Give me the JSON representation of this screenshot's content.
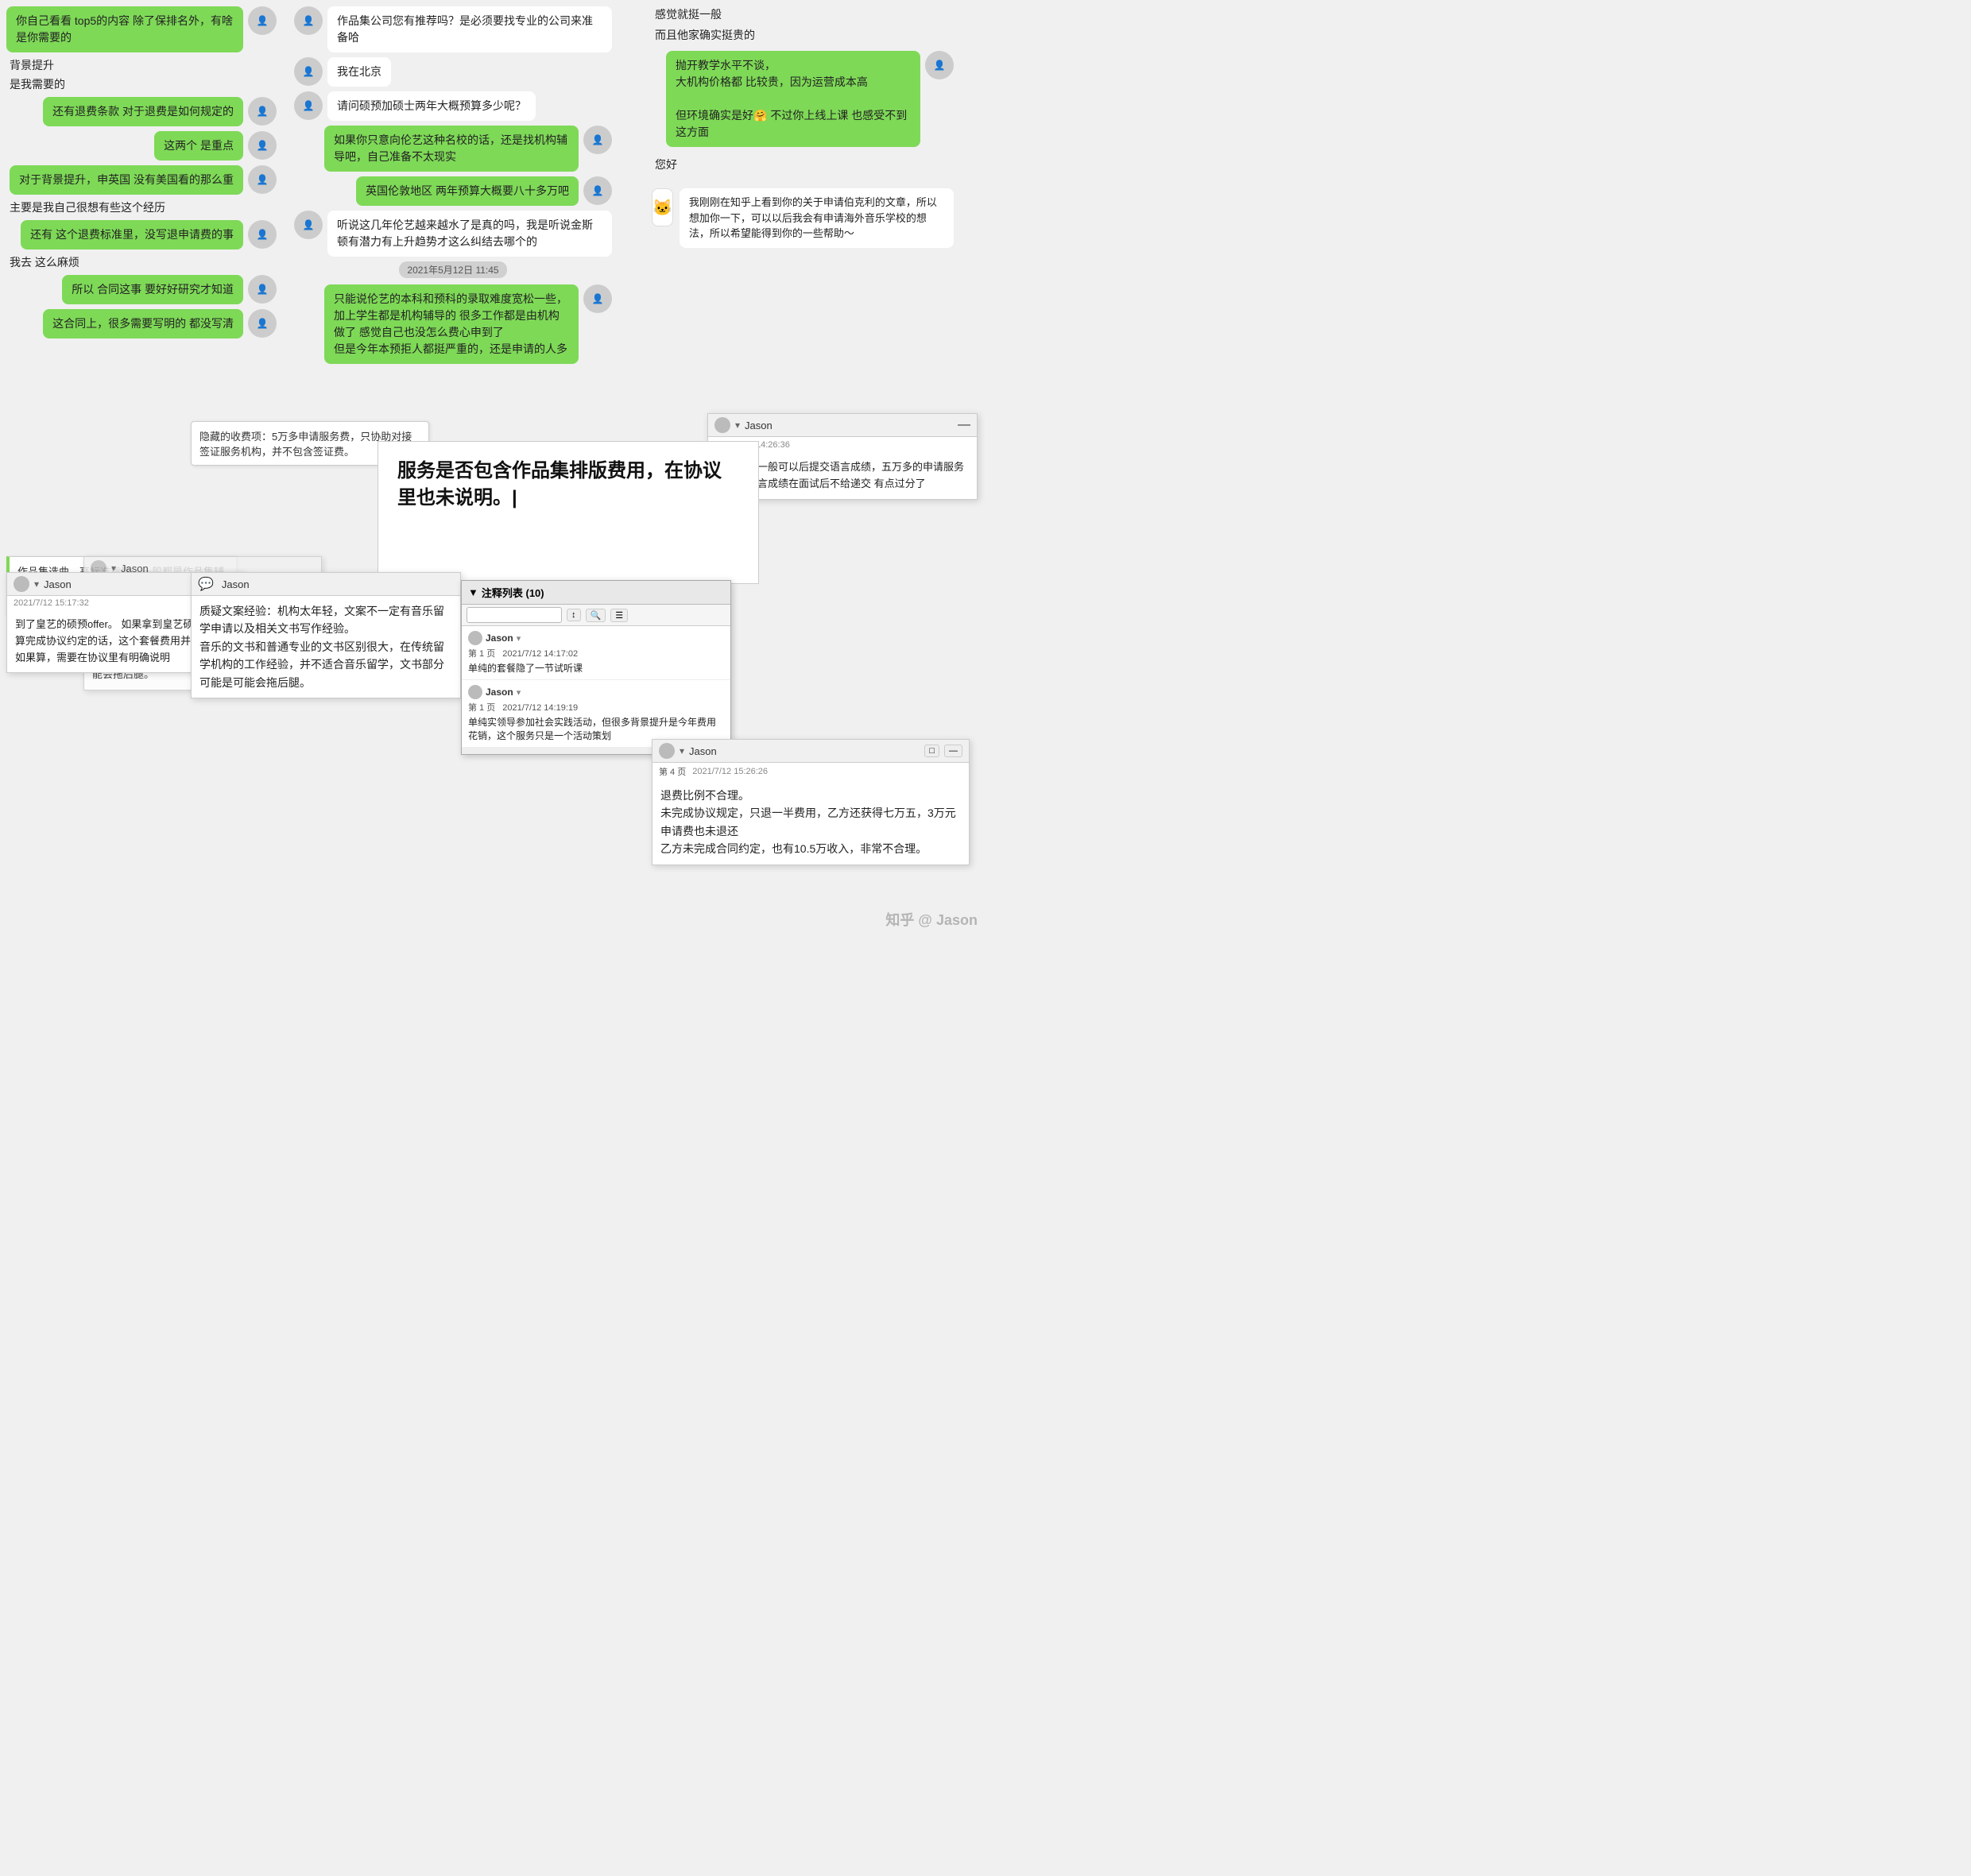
{
  "colors": {
    "green": "#7ed957",
    "white": "#ffffff",
    "bg": "#f5f5f5",
    "panel_bg": "#f0f0f0"
  },
  "chat_column_left": {
    "messages": [
      {
        "text": "你自己看看 top5的内容 除了保排名外，有啥是你需要的",
        "type": "green",
        "align": "right"
      },
      {
        "text": "背景提升",
        "type": "left_plain"
      },
      {
        "text": "是我需要的",
        "type": "left_plain"
      },
      {
        "text": "还有退费条款 对于退费是如何规定的",
        "type": "green",
        "align": "right"
      },
      {
        "text": "这两个 是重点",
        "type": "green",
        "align": "right"
      },
      {
        "text": "对于背景提升，申英国 没有美国看的那么重",
        "type": "green",
        "align": "right"
      },
      {
        "text": "主要是我自己很想有些这个经历",
        "type": "left_plain"
      },
      {
        "text": "还有 这个退费标准里，没写退申请费的事",
        "type": "green",
        "align": "right"
      },
      {
        "text": "我去 这么麻烦",
        "type": "left_plain"
      },
      {
        "text": "所以 合同这事 要好好研究才知道",
        "type": "green",
        "align": "right"
      },
      {
        "text": "这合同上，很多需要写明的 都没写清",
        "type": "green",
        "align": "right"
      }
    ]
  },
  "chat_column_middle": {
    "messages": [
      {
        "text": "作品集公司您有推荐吗？是必须要找专业的公司来准备哈",
        "type": "white"
      },
      {
        "text": "我在北京",
        "type": "white"
      },
      {
        "text": "请问硕预加硕士两年大概预算多少呢？",
        "type": "white"
      },
      {
        "text": "如果你只意向伦艺这种名校的话，还是找机构辅导吧，自己准备不太现实",
        "type": "green"
      },
      {
        "text": "英国伦敦地区 两年预算大概要八十多万吧",
        "type": "green"
      },
      {
        "text": "听说这几年伦艺越来越水了是真的吗，我是听说金斯顿有潜力有上升趋势才这么纠结去哪个的",
        "type": "white"
      },
      {
        "date": "2021年5月12日 11:45"
      },
      {
        "text": "只能说伦艺的本科和预科的录取难度宽松一些，加上学生都是机构辅导的 很多工作都是由机构做了 感觉自己也没怎么费心申到了\n但是今年本预拒人都挺严重的，还是申请的人多",
        "type": "green"
      }
    ]
  },
  "chat_column_right": {
    "messages": [
      {
        "text": "感觉就挺一般",
        "type": "right_plain"
      },
      {
        "text": "而且他家确实挺贵的",
        "type": "right_plain"
      },
      {
        "text": "抛开教学水平不谈，\n大机构价格都 比较贵，因为运营成本高\n\n但环境确实是好🤗 不过你上线上课 也感受不到这方面",
        "type": "green"
      },
      {
        "text": "您好",
        "type": "right_plain"
      }
    ]
  },
  "panel_top_right": {
    "user": "Jason",
    "timestamp": "2021/7/12 14:26:36",
    "text": "英国院校一般可以后提交语言成绩，五万多的申请服务费，却语言成绩在面试后不给递交 有点过分了"
  },
  "panel_hidden_fees": {
    "text": "隐藏的收费项：5万多申请服务费，只协助对接签证服务机构，并不包含签证费。"
  },
  "panel_service_question": {
    "text": "服务是否包含作品集排版费用，在协议里也未说明。",
    "has_cursor": true
  },
  "panel_jason_complaint": {
    "user": "Jason",
    "timestamp": "2021/7/12 15:17:32",
    "text": "到了皇艺的硕预offer。\n如果拿到皇艺硕预录取也算完成协议约定的话，这个套餐费用并不合理。\n如果算，需要在协议里有明确说明"
  },
  "panel_jason_complaint_shadow": {
    "user": "Jason",
    "timestamp": "2021/7/12 14:",
    "text": "质疑文案经验：机构太年轻，文案不一定有音乐留学申请以及相关文书写作经验。\n音乐的文书和普通专业的文书区别很大，在传统留学机构的工作经验，并不适合音乐留学，文书部分可能是可能会拖后腿。"
  },
  "panel_jason_big": {
    "user": "Jason",
    "text": "质疑文案经验：机构太年轻，文案不一定有音乐留学申请以及相关文书写作经验。\n音乐的文书和普通专业的文书区别很大，在传统留学机构的工作经验，并不适合音乐留学，文书部分可能是可能会拖后腿。"
  },
  "panel_refund": {
    "user": "Jason",
    "page": "第 4 页",
    "timestamp": "2021/7/12 15:26:26",
    "text": "退费比例不合理。\n未完成协议规定，只退一半费用，乙方还获得七万五，3万元申请费也未退还\n乙方未完成合同约定，也有10.5万收入，非常不合理。"
  },
  "annotation_panel": {
    "title": "注释列表 (10)",
    "search_placeholder": "",
    "items": [
      {
        "user": "Jason",
        "page": "第 1 页",
        "timestamp": "2021/7/12 14:17:02",
        "text": "单纯的套餐隐了一节试听课"
      },
      {
        "user": "Jason",
        "page": "第 1 页",
        "timestamp": "2021/7/12 14:19:19",
        "text": "单纯实领导参加社会实践活动，但很多背景提升是今年费用花销，这个服务只是一个活动策划"
      }
    ]
  },
  "panel_portfolio": {
    "text": "作品集选曲，高标准指导，一般都是作品集辅导时，专业老师根据你自身的情况去帮你选曲指导的，这项有点重复收费"
  },
  "panel_zhihu_intro": {
    "text": "我刚刚在知乎上看到你的关于申请伯克利的文章，所以想加你一下，可以以后我会有申请海外音乐学校的想法，所以希望能得到你的一些帮助～"
  },
  "watermark": {
    "text": "知乎 @ Jason"
  }
}
